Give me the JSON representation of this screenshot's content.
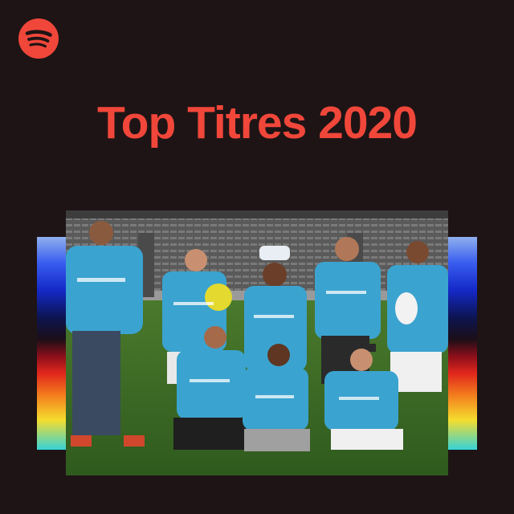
{
  "cover": {
    "title": "Top Titres 2020",
    "background_color": "#1e1415",
    "accent_color": "#f0473a",
    "logo_icon": "spotify-logo-icon",
    "photo_description_icon": "group-photo",
    "stripe_gradient": [
      "#8fb0ee",
      "#1d3eea",
      "#101a70",
      "#1a0f18",
      "#b3121b",
      "#f26a1e",
      "#f5dc2d",
      "#35d3d8"
    ]
  }
}
